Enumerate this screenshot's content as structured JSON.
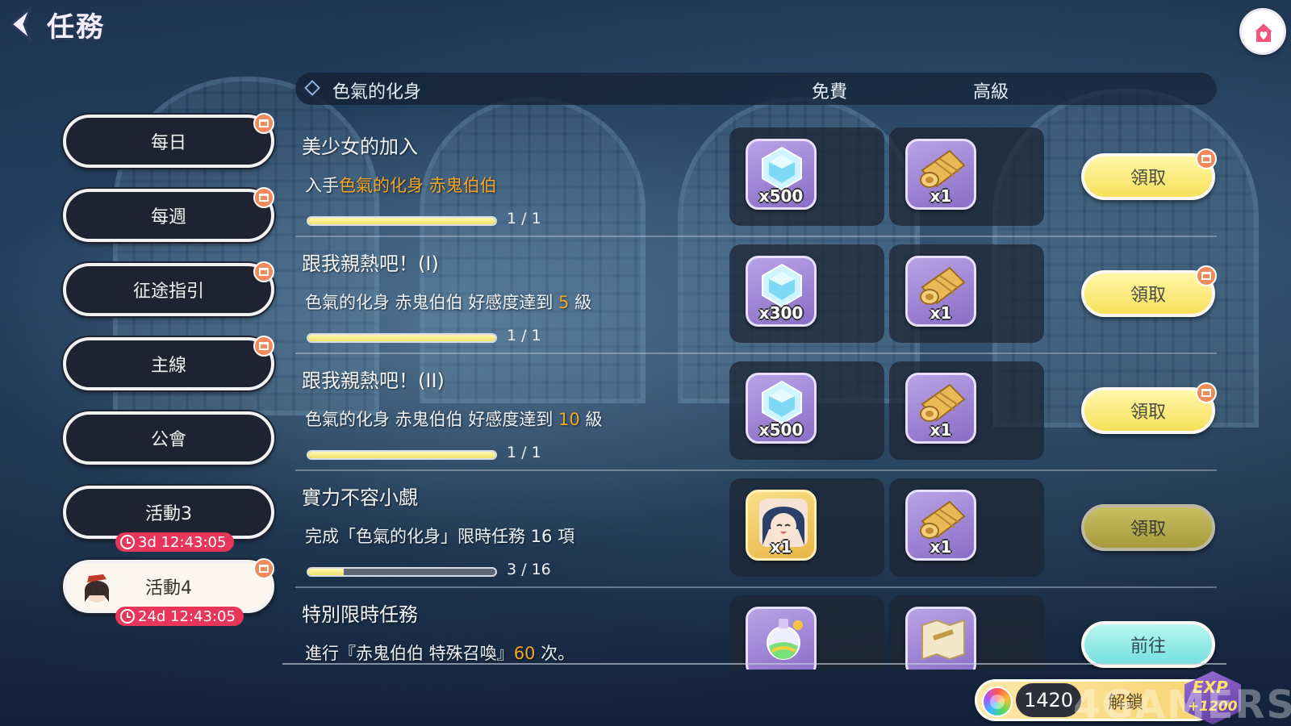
{
  "header": {
    "title": "任務"
  },
  "sidebar": {
    "items": [
      {
        "label": "每日",
        "badge": true,
        "active": false
      },
      {
        "label": "每週",
        "badge": true,
        "active": false
      },
      {
        "label": "征途指引",
        "badge": true,
        "active": false
      },
      {
        "label": "主線",
        "badge": true,
        "active": false
      },
      {
        "label": "公會",
        "badge": false,
        "active": false
      },
      {
        "label": "活動3",
        "badge": false,
        "active": false,
        "timer": "3d 12:43:05"
      },
      {
        "label": "活動4",
        "badge": true,
        "active": true,
        "timer": "24d 12:43:05"
      }
    ]
  },
  "list_header": {
    "title": "色氣的化身",
    "col_free": "免費",
    "col_premium": "高級"
  },
  "tasks": [
    {
      "title": "美少女的加入",
      "desc_prefix": "入手",
      "desc_highlight": "色氣的化身 赤鬼伯伯",
      "desc_suffix": "",
      "progress": 1.0,
      "progress_text": "1 / 1",
      "free_reward": {
        "icon": "crystal-icon",
        "qty": "x500"
      },
      "premium_reward": {
        "icon": "scroll-icon",
        "qty": "x1"
      },
      "button": "領取",
      "button_state": "claim"
    },
    {
      "title": "跟我親熱吧！(I)",
      "desc_prefix": "色氣的化身 赤鬼伯伯 好感度達到 ",
      "desc_highlight": "5",
      "desc_suffix": " 級",
      "progress": 1.0,
      "progress_text": "1 / 1",
      "free_reward": {
        "icon": "crystal-icon",
        "qty": "x300"
      },
      "premium_reward": {
        "icon": "scroll-icon",
        "qty": "x1"
      },
      "button": "領取",
      "button_state": "claim"
    },
    {
      "title": "跟我親熱吧！(II)",
      "desc_prefix": "色氣的化身 赤鬼伯伯 好感度達到 ",
      "desc_highlight": "10",
      "desc_suffix": " 級",
      "progress": 1.0,
      "progress_text": "1 / 1",
      "free_reward": {
        "icon": "crystal-icon",
        "qty": "x500"
      },
      "premium_reward": {
        "icon": "scroll-icon",
        "qty": "x1"
      },
      "button": "領取",
      "button_state": "claim"
    },
    {
      "title": "實力不容小覷",
      "desc_prefix": "完成「色氣的化身」限時任務 16 項",
      "desc_highlight": "",
      "desc_suffix": "",
      "progress": 0.1875,
      "progress_text": "3 / 16",
      "free_reward": {
        "icon": "character-portrait-icon",
        "qty": "x1"
      },
      "premium_reward": {
        "icon": "scroll-icon",
        "qty": "x1"
      },
      "button": "領取",
      "button_state": "disabled"
    },
    {
      "title": "特別限時任務",
      "desc_prefix": "進行『赤鬼伯伯 特殊召喚』",
      "desc_highlight": "60",
      "desc_suffix": " 次。",
      "progress": null,
      "progress_text": "",
      "free_reward": {
        "icon": "potion-icon",
        "qty": ""
      },
      "premium_reward": {
        "icon": "map-icon",
        "qty": ""
      },
      "button": "前往",
      "button_state": "go"
    }
  ],
  "footer": {
    "coin_value": "1420",
    "unlock_label": "解鎖",
    "exp_label": "EXP",
    "exp_value": "+1200"
  },
  "watermark": "4GAMERS",
  "colors": {
    "highlight": "#f3a526",
    "claim": "#f6e05a",
    "go": "#74e0dd",
    "timer": "#e8365a"
  }
}
